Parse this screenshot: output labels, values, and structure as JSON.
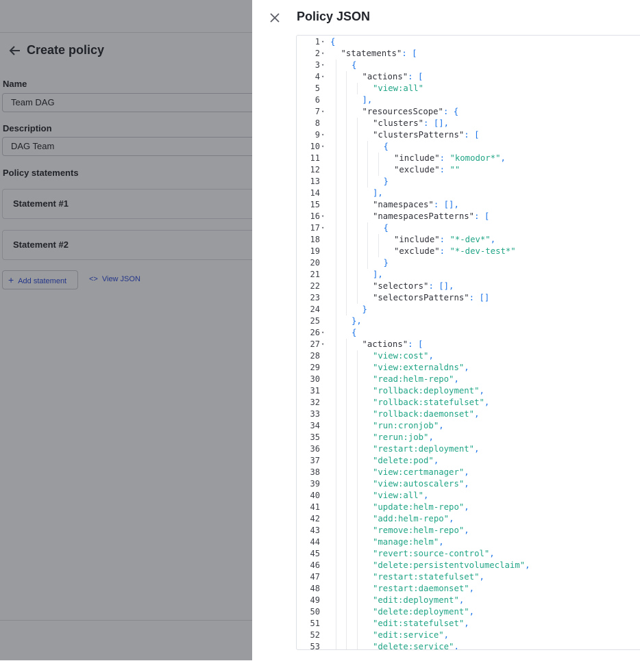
{
  "background": {
    "page_title": "Create policy",
    "name_label": "Name",
    "name_value": "Team DAG",
    "description_label": "Description",
    "description_value": "DAG Team",
    "statements_label": "Policy statements",
    "statements": [
      "Statement #1",
      "Statement #2"
    ],
    "add_statement_label": "Add statement",
    "view_json_label": "View JSON"
  },
  "drawer": {
    "title": "Policy JSON"
  },
  "code": {
    "lines": [
      {
        "n": "1",
        "fold": true,
        "d": 0,
        "t": [
          [
            "p",
            "{"
          ]
        ]
      },
      {
        "n": "2",
        "fold": true,
        "d": 1,
        "t": [
          [
            "k",
            "\"statements\""
          ],
          [
            "p",
            ": ["
          ]
        ]
      },
      {
        "n": "3",
        "fold": true,
        "d": 2,
        "t": [
          [
            "p",
            "{"
          ]
        ]
      },
      {
        "n": "4",
        "fold": true,
        "d": 3,
        "t": [
          [
            "k",
            "\"actions\""
          ],
          [
            "p",
            ": ["
          ]
        ]
      },
      {
        "n": "5",
        "fold": false,
        "d": 4,
        "t": [
          [
            "s",
            "\"view:all\""
          ]
        ]
      },
      {
        "n": "6",
        "fold": false,
        "d": 3,
        "t": [
          [
            "p",
            "],"
          ]
        ]
      },
      {
        "n": "7",
        "fold": true,
        "d": 3,
        "t": [
          [
            "k",
            "\"resourcesScope\""
          ],
          [
            "p",
            ": {"
          ]
        ]
      },
      {
        "n": "8",
        "fold": false,
        "d": 4,
        "t": [
          [
            "k",
            "\"clusters\""
          ],
          [
            "p",
            ": [],"
          ]
        ]
      },
      {
        "n": "9",
        "fold": true,
        "d": 4,
        "t": [
          [
            "k",
            "\"clustersPatterns\""
          ],
          [
            "p",
            ": ["
          ]
        ]
      },
      {
        "n": "10",
        "fold": true,
        "d": 5,
        "t": [
          [
            "p",
            "{"
          ]
        ]
      },
      {
        "n": "11",
        "fold": false,
        "d": 6,
        "t": [
          [
            "k",
            "\"include\""
          ],
          [
            "p",
            ": "
          ],
          [
            "s",
            "\"komodor*\""
          ],
          [
            "p",
            ","
          ]
        ]
      },
      {
        "n": "12",
        "fold": false,
        "d": 6,
        "t": [
          [
            "k",
            "\"exclude\""
          ],
          [
            "p",
            ": "
          ],
          [
            "s",
            "\"\""
          ]
        ]
      },
      {
        "n": "13",
        "fold": false,
        "d": 5,
        "t": [
          [
            "p",
            "}"
          ]
        ]
      },
      {
        "n": "14",
        "fold": false,
        "d": 4,
        "t": [
          [
            "p",
            "],"
          ]
        ]
      },
      {
        "n": "15",
        "fold": false,
        "d": 4,
        "t": [
          [
            "k",
            "\"namespaces\""
          ],
          [
            "p",
            ": [],"
          ]
        ]
      },
      {
        "n": "16",
        "fold": true,
        "d": 4,
        "t": [
          [
            "k",
            "\"namespacesPatterns\""
          ],
          [
            "p",
            ": ["
          ]
        ]
      },
      {
        "n": "17",
        "fold": true,
        "d": 5,
        "t": [
          [
            "p",
            "{"
          ]
        ]
      },
      {
        "n": "18",
        "fold": false,
        "d": 6,
        "t": [
          [
            "k",
            "\"include\""
          ],
          [
            "p",
            ": "
          ],
          [
            "s",
            "\"*-dev*\""
          ],
          [
            "p",
            ","
          ]
        ]
      },
      {
        "n": "19",
        "fold": false,
        "d": 6,
        "t": [
          [
            "k",
            "\"exclude\""
          ],
          [
            "p",
            ": "
          ],
          [
            "s",
            "\"*-dev-test*\""
          ]
        ]
      },
      {
        "n": "20",
        "fold": false,
        "d": 5,
        "t": [
          [
            "p",
            "}"
          ]
        ]
      },
      {
        "n": "21",
        "fold": false,
        "d": 4,
        "t": [
          [
            "p",
            "],"
          ]
        ]
      },
      {
        "n": "22",
        "fold": false,
        "d": 4,
        "t": [
          [
            "k",
            "\"selectors\""
          ],
          [
            "p",
            ": [],"
          ]
        ]
      },
      {
        "n": "23",
        "fold": false,
        "d": 4,
        "t": [
          [
            "k",
            "\"selectorsPatterns\""
          ],
          [
            "p",
            ": []"
          ]
        ]
      },
      {
        "n": "24",
        "fold": false,
        "d": 3,
        "t": [
          [
            "p",
            "}"
          ]
        ]
      },
      {
        "n": "25",
        "fold": false,
        "d": 2,
        "t": [
          [
            "p",
            "},"
          ]
        ]
      },
      {
        "n": "26",
        "fold": true,
        "d": 2,
        "t": [
          [
            "p",
            "{"
          ]
        ]
      },
      {
        "n": "27",
        "fold": true,
        "d": 3,
        "t": [
          [
            "k",
            "\"actions\""
          ],
          [
            "p",
            ": ["
          ]
        ]
      },
      {
        "n": "28",
        "fold": false,
        "d": 4,
        "t": [
          [
            "s",
            "\"view:cost\""
          ],
          [
            "p",
            ","
          ]
        ]
      },
      {
        "n": "29",
        "fold": false,
        "d": 4,
        "t": [
          [
            "s",
            "\"view:externaldns\""
          ],
          [
            "p",
            ","
          ]
        ]
      },
      {
        "n": "30",
        "fold": false,
        "d": 4,
        "t": [
          [
            "s",
            "\"read:helm-repo\""
          ],
          [
            "p",
            ","
          ]
        ]
      },
      {
        "n": "31",
        "fold": false,
        "d": 4,
        "t": [
          [
            "s",
            "\"rollback:deployment\""
          ],
          [
            "p",
            ","
          ]
        ]
      },
      {
        "n": "32",
        "fold": false,
        "d": 4,
        "t": [
          [
            "s",
            "\"rollback:statefulset\""
          ],
          [
            "p",
            ","
          ]
        ]
      },
      {
        "n": "33",
        "fold": false,
        "d": 4,
        "t": [
          [
            "s",
            "\"rollback:daemonset\""
          ],
          [
            "p",
            ","
          ]
        ]
      },
      {
        "n": "34",
        "fold": false,
        "d": 4,
        "t": [
          [
            "s",
            "\"run:cronjob\""
          ],
          [
            "p",
            ","
          ]
        ]
      },
      {
        "n": "35",
        "fold": false,
        "d": 4,
        "t": [
          [
            "s",
            "\"rerun:job\""
          ],
          [
            "p",
            ","
          ]
        ]
      },
      {
        "n": "36",
        "fold": false,
        "d": 4,
        "t": [
          [
            "s",
            "\"restart:deployment\""
          ],
          [
            "p",
            ","
          ]
        ]
      },
      {
        "n": "37",
        "fold": false,
        "d": 4,
        "t": [
          [
            "s",
            "\"delete:pod\""
          ],
          [
            "p",
            ","
          ]
        ]
      },
      {
        "n": "38",
        "fold": false,
        "d": 4,
        "t": [
          [
            "s",
            "\"view:certmanager\""
          ],
          [
            "p",
            ","
          ]
        ]
      },
      {
        "n": "39",
        "fold": false,
        "d": 4,
        "t": [
          [
            "s",
            "\"view:autoscalers\""
          ],
          [
            "p",
            ","
          ]
        ]
      },
      {
        "n": "40",
        "fold": false,
        "d": 4,
        "t": [
          [
            "s",
            "\"view:all\""
          ],
          [
            "p",
            ","
          ]
        ]
      },
      {
        "n": "41",
        "fold": false,
        "d": 4,
        "t": [
          [
            "s",
            "\"update:helm-repo\""
          ],
          [
            "p",
            ","
          ]
        ]
      },
      {
        "n": "42",
        "fold": false,
        "d": 4,
        "t": [
          [
            "s",
            "\"add:helm-repo\""
          ],
          [
            "p",
            ","
          ]
        ]
      },
      {
        "n": "43",
        "fold": false,
        "d": 4,
        "t": [
          [
            "s",
            "\"remove:helm-repo\""
          ],
          [
            "p",
            ","
          ]
        ]
      },
      {
        "n": "44",
        "fold": false,
        "d": 4,
        "t": [
          [
            "s",
            "\"manage:helm\""
          ],
          [
            "p",
            ","
          ]
        ]
      },
      {
        "n": "45",
        "fold": false,
        "d": 4,
        "t": [
          [
            "s",
            "\"revert:source-control\""
          ],
          [
            "p",
            ","
          ]
        ]
      },
      {
        "n": "46",
        "fold": false,
        "d": 4,
        "t": [
          [
            "s",
            "\"delete:persistentvolumeclaim\""
          ],
          [
            "p",
            ","
          ]
        ]
      },
      {
        "n": "47",
        "fold": false,
        "d": 4,
        "t": [
          [
            "s",
            "\"restart:statefulset\""
          ],
          [
            "p",
            ","
          ]
        ]
      },
      {
        "n": "48",
        "fold": false,
        "d": 4,
        "t": [
          [
            "s",
            "\"restart:daemonset\""
          ],
          [
            "p",
            ","
          ]
        ]
      },
      {
        "n": "49",
        "fold": false,
        "d": 4,
        "t": [
          [
            "s",
            "\"edit:deployment\""
          ],
          [
            "p",
            ","
          ]
        ]
      },
      {
        "n": "50",
        "fold": false,
        "d": 4,
        "t": [
          [
            "s",
            "\"delete:deployment\""
          ],
          [
            "p",
            ","
          ]
        ]
      },
      {
        "n": "51",
        "fold": false,
        "d": 4,
        "t": [
          [
            "s",
            "\"edit:statefulset\""
          ],
          [
            "p",
            ","
          ]
        ]
      },
      {
        "n": "52",
        "fold": false,
        "d": 4,
        "t": [
          [
            "s",
            "\"edit:service\""
          ],
          [
            "p",
            ","
          ]
        ]
      },
      {
        "n": "53",
        "fold": false,
        "d": 4,
        "t": [
          [
            "s",
            "\"delete:service\""
          ],
          [
            "p",
            ","
          ]
        ]
      }
    ]
  },
  "colors": {
    "key": "#30323a",
    "string": "#21a586",
    "punctuation": "#1a73e8"
  }
}
